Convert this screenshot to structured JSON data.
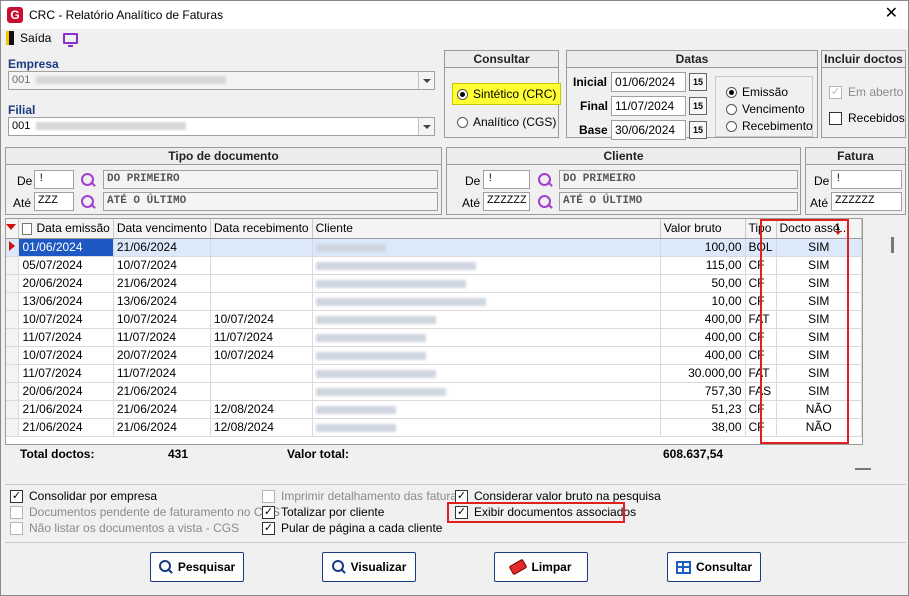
{
  "window": {
    "title": "CRC - Relatório Analítico de Faturas",
    "app_icon": "G"
  },
  "toolbar": {
    "exit_label": "Saída"
  },
  "empresa": {
    "label": "Empresa",
    "code": "001"
  },
  "filial": {
    "label": "Filial",
    "code": "001"
  },
  "consultar": {
    "title": "Consultar",
    "options": [
      "Sintético (CRC)",
      "Analítico (CGS)"
    ],
    "selected": "Sintético (CRC)"
  },
  "datas": {
    "title": "Datas",
    "inicial_label": "Inicial",
    "inicial": "01/06/2024",
    "final_label": "Final",
    "final": "11/07/2024",
    "base_label": "Base",
    "base": "30/06/2024",
    "cal_icon_text": "15",
    "options": [
      "Emissão",
      "Vencimento",
      "Recebimento"
    ],
    "selected": "Emissão"
  },
  "incluir": {
    "title": "Incluir doctos",
    "em_aberto": "Em aberto",
    "recebidos": "Recebidos"
  },
  "tipo_documento": {
    "title": "Tipo de documento",
    "de_label": "De",
    "de": "!",
    "ate_label": "Até",
    "ate": "ZZZ",
    "de_desc": "DO PRIMEIRO",
    "ate_desc": "ATÉ O ÚLTIMO"
  },
  "cliente": {
    "title": "Cliente",
    "de_label": "De",
    "de": "!",
    "ate_label": "Até",
    "ate": "ZZZZZZ",
    "de_desc": "DO PRIMEIRO",
    "ate_desc": "ATÉ O ÚLTIMO"
  },
  "fatura": {
    "title": "Fatura",
    "de_label": "De",
    "de": "!",
    "ate_label": "Até",
    "ate": "ZZZZZZ"
  },
  "grid": {
    "columns": [
      "Data emissão",
      "Data vencimento",
      "Data recebimento",
      "Cliente",
      "Valor bruto",
      "Tipo",
      "Docto asso..."
    ],
    "sort_marker": "1",
    "rows": [
      {
        "emissao": "01/06/2024",
        "vencimento": "21/06/2024",
        "recebimento": "",
        "valor": "100,00",
        "tipo": "BOL",
        "docto": "SIM"
      },
      {
        "emissao": "05/07/2024",
        "vencimento": "10/07/2024",
        "recebimento": "",
        "valor": "115,00",
        "tipo": "CF",
        "docto": "SIM"
      },
      {
        "emissao": "20/06/2024",
        "vencimento": "21/06/2024",
        "recebimento": "",
        "valor": "50,00",
        "tipo": "CF",
        "docto": "SIM"
      },
      {
        "emissao": "13/06/2024",
        "vencimento": "13/06/2024",
        "recebimento": "",
        "valor": "10,00",
        "tipo": "CF",
        "docto": "SIM"
      },
      {
        "emissao": "10/07/2024",
        "vencimento": "10/07/2024",
        "recebimento": "10/07/2024",
        "valor": "400,00",
        "tipo": "FAT",
        "docto": "SIM"
      },
      {
        "emissao": "11/07/2024",
        "vencimento": "11/07/2024",
        "recebimento": "11/07/2024",
        "valor": "400,00",
        "tipo": "CF",
        "docto": "SIM"
      },
      {
        "emissao": "10/07/2024",
        "vencimento": "20/07/2024",
        "recebimento": "10/07/2024",
        "valor": "400,00",
        "tipo": "CF",
        "docto": "SIM"
      },
      {
        "emissao": "11/07/2024",
        "vencimento": "11/07/2024",
        "recebimento": "",
        "valor": "30.000,00",
        "tipo": "FAT",
        "docto": "SIM"
      },
      {
        "emissao": "20/06/2024",
        "vencimento": "21/06/2024",
        "recebimento": "",
        "valor": "757,30",
        "tipo": "FAS",
        "docto": "SIM"
      },
      {
        "emissao": "21/06/2024",
        "vencimento": "21/06/2024",
        "recebimento": "12/08/2024",
        "valor": "51,23",
        "tipo": "CF",
        "docto": "NÃO"
      },
      {
        "emissao": "21/06/2024",
        "vencimento": "21/06/2024",
        "recebimento": "12/08/2024",
        "valor": "38,00",
        "tipo": "CF",
        "docto": "NÃO"
      }
    ],
    "footer": {
      "total_label": "Total doctos:",
      "total": "431",
      "valor_label": "Valor total:",
      "valor": "608.637,54"
    }
  },
  "options": {
    "consolidar": "Consolidar por empresa",
    "pendente": "Documentos pendente de faturamento no CGS",
    "nao_listar": "Não listar os documentos a vista - CGS",
    "imprimir": "Imprimir detalhamento das faturas",
    "totalizar": "Totalizar por cliente",
    "pular": "Pular de página a cada cliente",
    "considerar": "Considerar valor bruto na pesquisa",
    "exibir": "Exibir documentos associados"
  },
  "buttons": {
    "pesquisar": "Pesquisar",
    "visualizar": "Visualizar",
    "limpar": "Limpar",
    "consultar": "Consultar"
  },
  "colors": {
    "highlight": "#ffff33",
    "annotation": "#e0201e",
    "accent": "#1a3b82"
  }
}
